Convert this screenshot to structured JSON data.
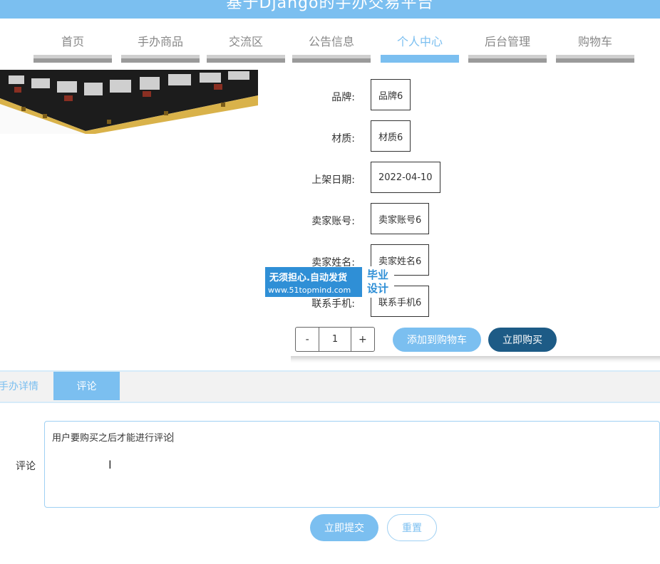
{
  "header": {
    "title": "基于Django的手办交易平台"
  },
  "nav": [
    {
      "label": "首页",
      "active": false
    },
    {
      "label": "手办商品",
      "active": false
    },
    {
      "label": "交流区",
      "active": false
    },
    {
      "label": "公告信息",
      "active": false
    },
    {
      "label": "个人中心",
      "active": true
    },
    {
      "label": "后台管理",
      "active": false
    },
    {
      "label": "购物车",
      "active": false
    }
  ],
  "fields": [
    {
      "label": "品牌:",
      "value": "品牌6"
    },
    {
      "label": "材质:",
      "value": "材质6"
    },
    {
      "label": "上架日期:",
      "value": "2022-04-10"
    },
    {
      "label": "卖家账号:",
      "value": "卖家账号6"
    },
    {
      "label": "卖家姓名:",
      "value": "卖家姓名6"
    },
    {
      "label": "联系手机:",
      "value": "联系手机6"
    }
  ],
  "quantity": {
    "minus": "-",
    "value": "1",
    "plus": "+"
  },
  "actions": {
    "add_to_cart": "添加到购物车",
    "buy_now": "立即购买"
  },
  "tabs": [
    {
      "label": "手办详情",
      "active": false
    },
    {
      "label": "评论",
      "active": true
    }
  ],
  "comment": {
    "label": "评论",
    "text": "用户要购买之后才能进行评论",
    "submit": "立即提交",
    "reset": "重置"
  },
  "watermark": {
    "line1": "无须担心.自动发货",
    "line2": "www.51topmind.com",
    "badge": [
      "毕业",
      "设计"
    ]
  },
  "colors": {
    "accent": "#7bbff0",
    "dark_button": "#1d5b86",
    "nav_inactive": "#9a9a9a"
  }
}
